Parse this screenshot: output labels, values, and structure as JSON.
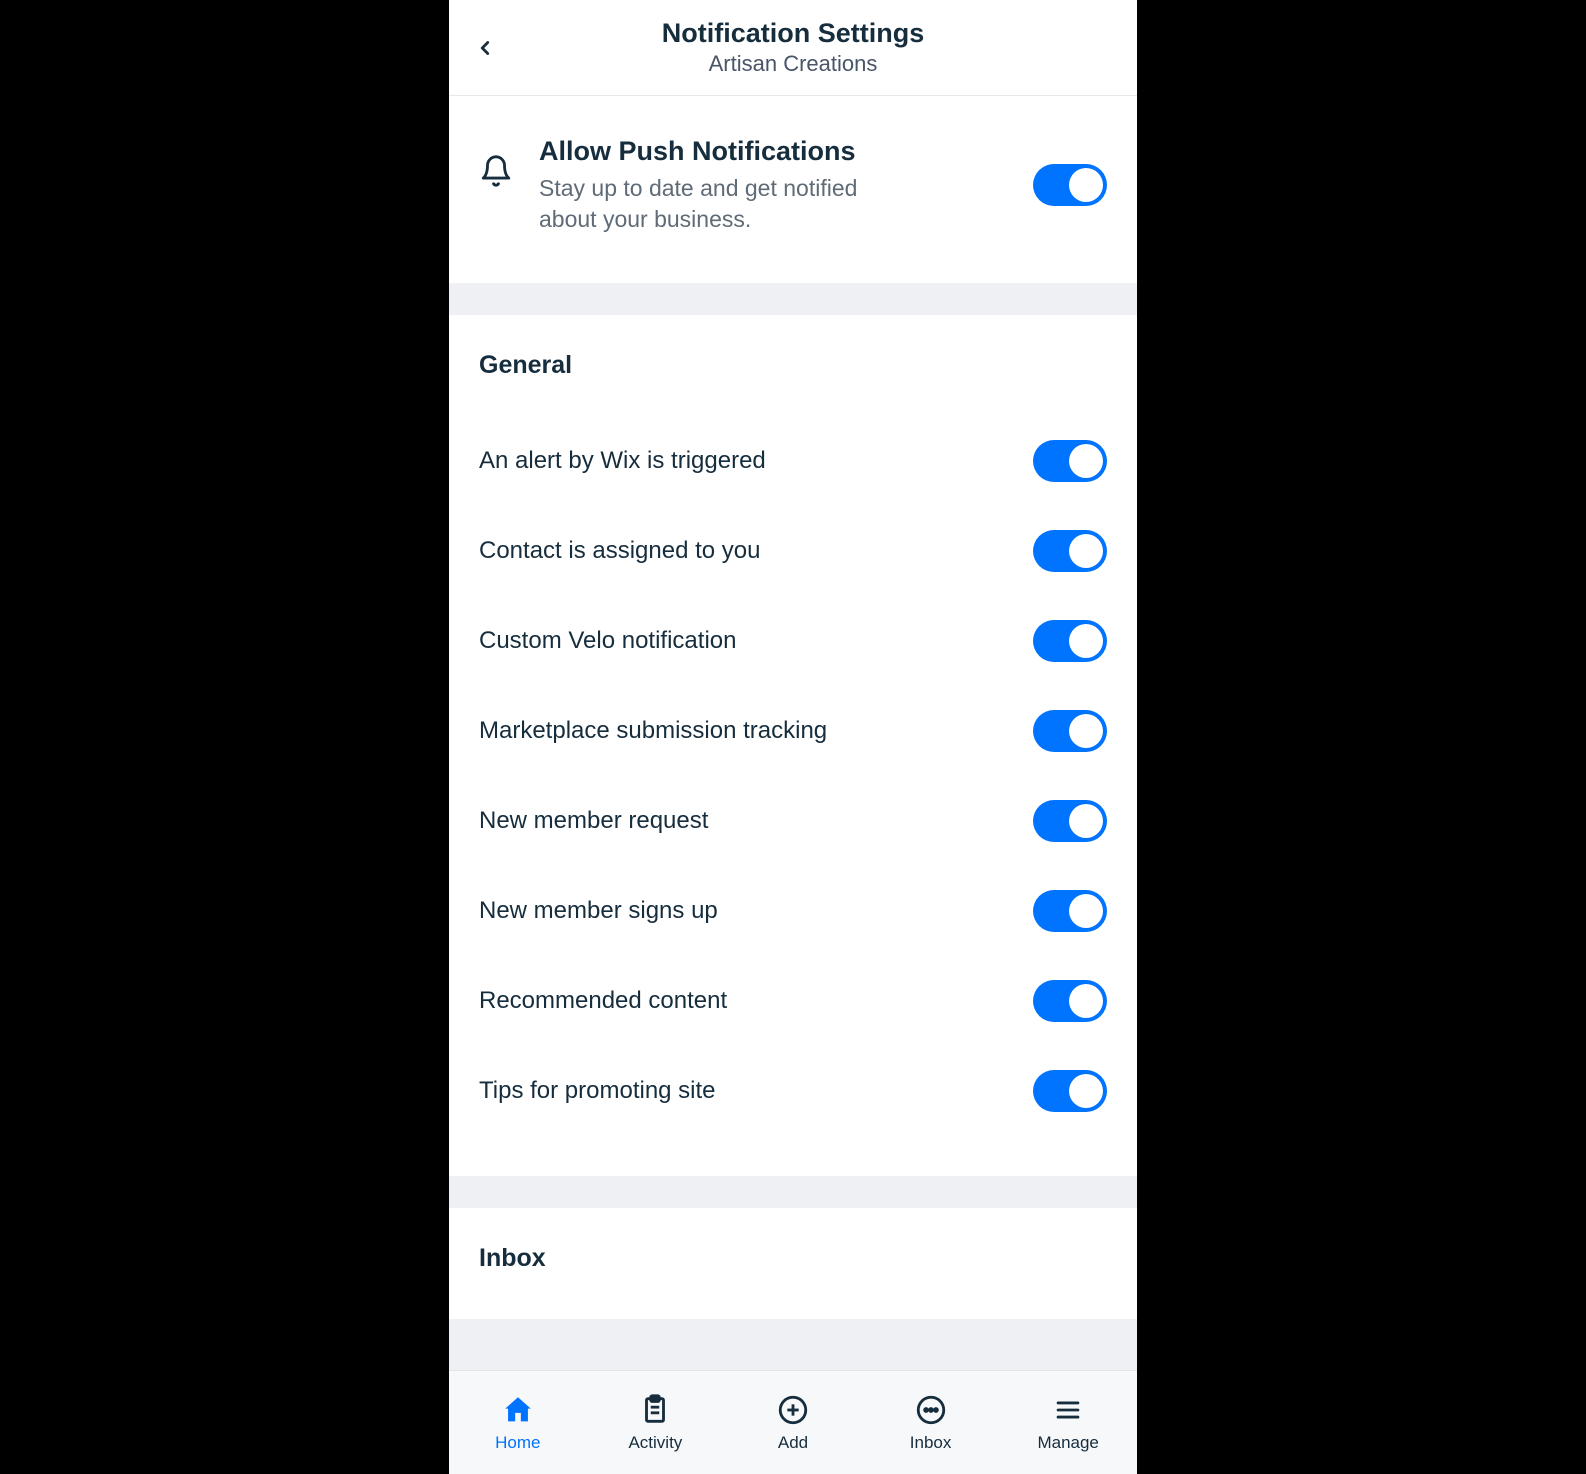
{
  "header": {
    "title": "Notification Settings",
    "subtitle": "Artisan Creations"
  },
  "push": {
    "title": "Allow Push Notifications",
    "description": "Stay up to date and get notified about your business.",
    "enabled": true
  },
  "sections": [
    {
      "title": "General",
      "items": [
        {
          "label": "An alert by Wix is triggered",
          "enabled": true
        },
        {
          "label": "Contact is assigned to you",
          "enabled": true
        },
        {
          "label": "Custom Velo notification",
          "enabled": true
        },
        {
          "label": "Marketplace submission tracking",
          "enabled": true
        },
        {
          "label": "New member request",
          "enabled": true
        },
        {
          "label": "New member signs up",
          "enabled": true
        },
        {
          "label": "Recommended content",
          "enabled": true
        },
        {
          "label": "Tips for promoting site",
          "enabled": true
        }
      ]
    },
    {
      "title": "Inbox",
      "items": []
    }
  ],
  "nav": {
    "items": [
      {
        "key": "home",
        "label": "Home",
        "active": true
      },
      {
        "key": "activity",
        "label": "Activity",
        "active": false
      },
      {
        "key": "add",
        "label": "Add",
        "active": false
      },
      {
        "key": "inbox",
        "label": "Inbox",
        "active": false
      },
      {
        "key": "manage",
        "label": "Manage",
        "active": false
      }
    ]
  },
  "icons": {
    "back": "chevron-left-icon",
    "bell": "bell-icon",
    "home": "home-icon",
    "activity": "clipboard-icon",
    "add": "plus-circle-icon",
    "inbox": "chat-icon",
    "manage": "menu-icon"
  }
}
